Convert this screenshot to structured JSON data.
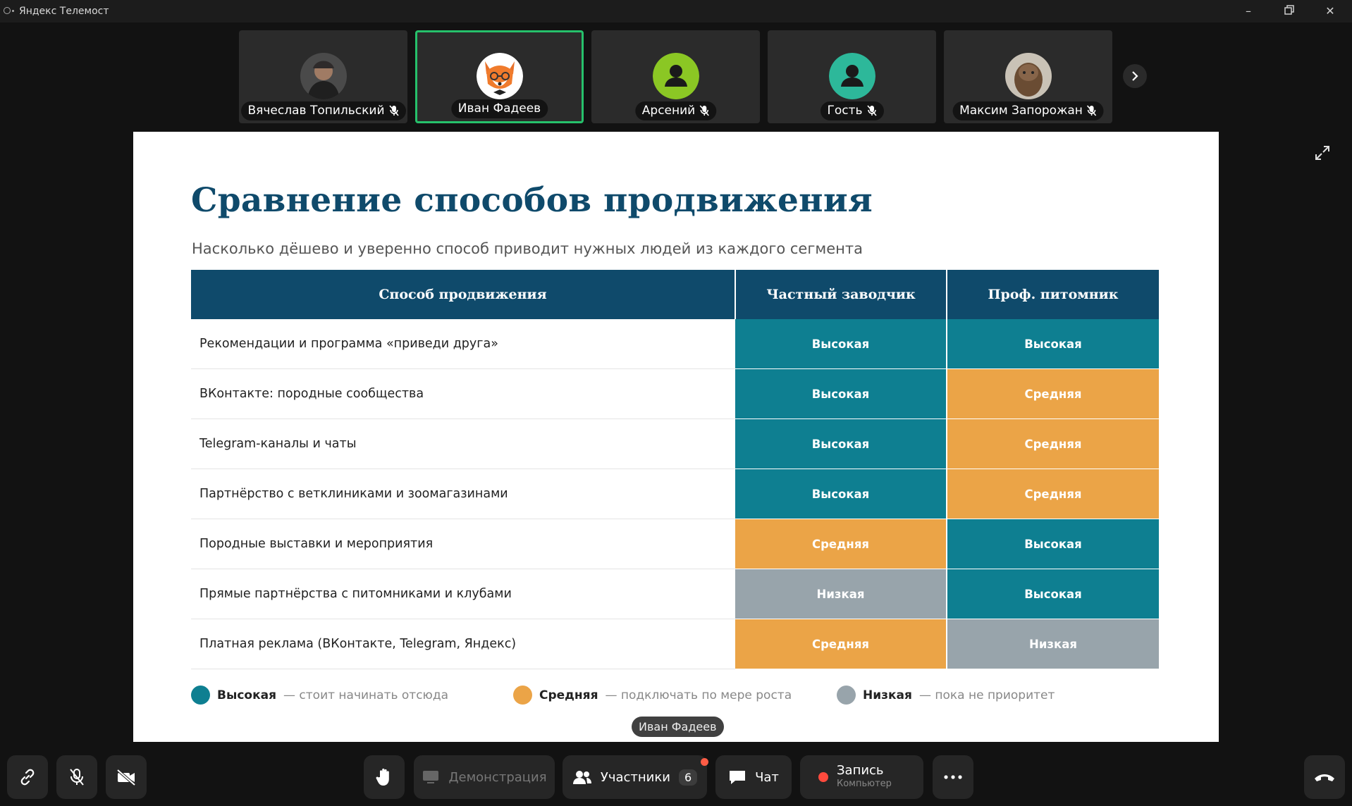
{
  "window": {
    "title": "Яндекс Телемост"
  },
  "participants_strip": {
    "tiles": [
      {
        "name": "Вячеслав Топильский",
        "avatar": "photo-avatar",
        "muted": true,
        "active": false
      },
      {
        "name": "Иван Фадеев",
        "avatar": "fox-avatar",
        "muted": false,
        "active": true
      },
      {
        "name": "Арсений",
        "avatar": "generic-user-avatar",
        "color": "#8bc724",
        "muted": true,
        "active": false
      },
      {
        "name": "Гость",
        "avatar": "generic-user-avatar",
        "color": "#2db89a",
        "muted": true,
        "active": false
      },
      {
        "name": "Максим Запорожан",
        "avatar": "photo-avatar",
        "muted": true,
        "active": false
      }
    ]
  },
  "slide": {
    "title": "Сравнение способов продвижения",
    "subtitle": "Насколько дёшево и уверенно способ приводит нужных людей из каждого сегмента",
    "table": {
      "headers": [
        "Способ продвижения",
        "Частный заводчик",
        "Проф. питомник"
      ],
      "rows": [
        {
          "method": "Рекомендации и программа «приведи друга»",
          "private": "Высокая",
          "private_level": "high",
          "kennel": "Высокая",
          "kennel_level": "high"
        },
        {
          "method": "ВКонтакте: породные сообщества",
          "private": "Высокая",
          "private_level": "high",
          "kennel": "Средняя",
          "kennel_level": "mid"
        },
        {
          "method": "Telegram-каналы и чаты",
          "private": "Высокая",
          "private_level": "high",
          "kennel": "Средняя",
          "kennel_level": "mid"
        },
        {
          "method": "Партнёрство с ветклиниками и зоомагазинами",
          "private": "Высокая",
          "private_level": "high",
          "kennel": "Средняя",
          "kennel_level": "mid"
        },
        {
          "method": "Породные выставки и мероприятия",
          "private": "Средняя",
          "private_level": "mid",
          "kennel": "Высокая",
          "kennel_level": "high"
        },
        {
          "method": "Прямые партнёрства с питомниками и клубами",
          "private": "Низкая",
          "private_level": "low",
          "kennel": "Высокая",
          "kennel_level": "high"
        },
        {
          "method": "Платная реклама (ВКонтакте, Telegram, Яндекс)",
          "private": "Средняя",
          "private_level": "mid",
          "kennel": "Низкая",
          "kennel_level": "low"
        }
      ]
    },
    "legend": [
      {
        "label": "Высокая",
        "desc": "— стоит начинать отсюда",
        "color": "#0e7f91"
      },
      {
        "label": "Средняя",
        "desc": "— подключать по мере роста",
        "color": "#eba447"
      },
      {
        "label": "Низкая",
        "desc": "— пока не приоритет",
        "color": "#98a4ab"
      }
    ]
  },
  "presenter_label": "Иван Фадеев",
  "toolbar": {
    "demo_label": "Демонстрация",
    "participants_label": "Участники",
    "participants_count": "6",
    "chat_label": "Чат",
    "record_label": "Запись",
    "record_sub": "Компьютер"
  },
  "colors": {
    "high": "#0e7f91",
    "mid": "#eba447",
    "low": "#98a4ab",
    "active_border": "#26c16b",
    "heading": "#0f4a6b"
  }
}
